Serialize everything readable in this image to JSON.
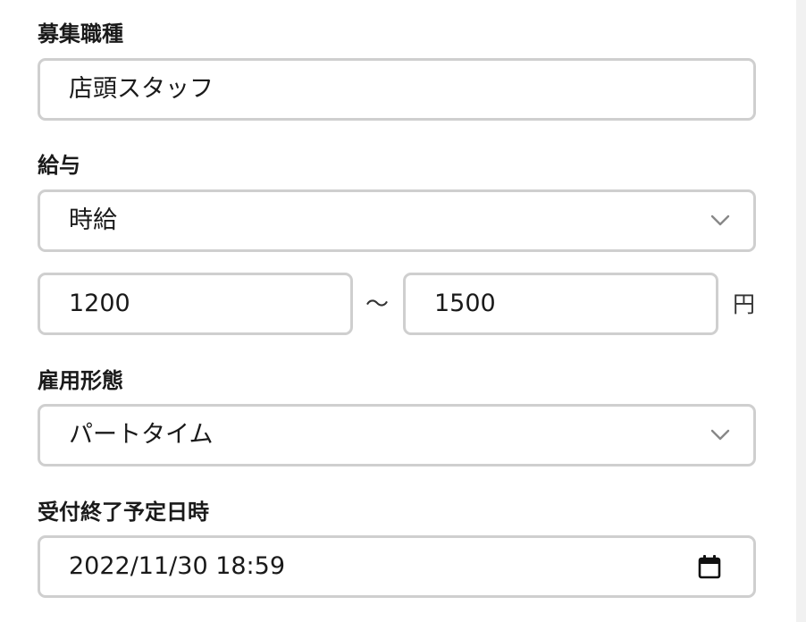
{
  "job_type": {
    "label": "募集職種",
    "value": "店頭スタッフ"
  },
  "salary": {
    "label": "給与",
    "type_value": "時給",
    "min_value": "1200",
    "range_separator": "〜",
    "max_value": "1500",
    "unit": "円"
  },
  "employment": {
    "label": "雇用形態",
    "value": "パートタイム"
  },
  "deadline": {
    "label": "受付終了予定日時",
    "value": "2022/11/30 18:59"
  },
  "icons": {
    "salary_type_dropdown": "chevron-down-icon",
    "employment_dropdown": "chevron-down-icon",
    "deadline_picker": "calendar-icon"
  },
  "colors": {
    "border": "#cfcfcf",
    "text": "#1a1a1a",
    "scrollbar_track": "#f1f1f1"
  }
}
